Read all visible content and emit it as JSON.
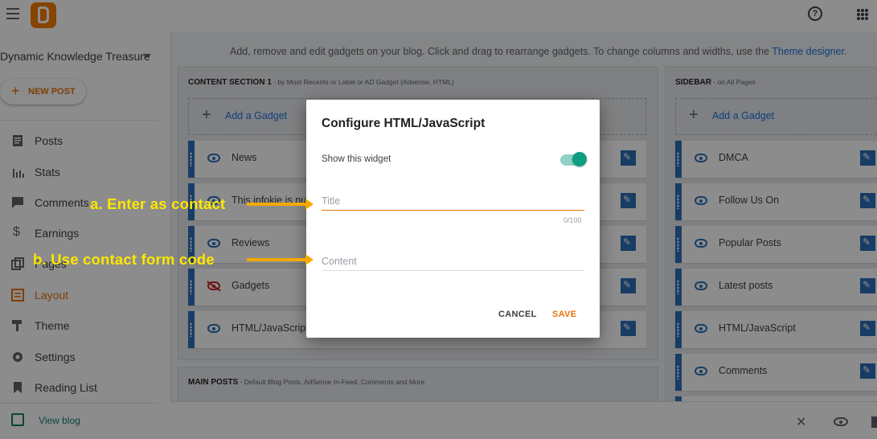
{
  "header": {
    "menu_icon": "hamburger-icon",
    "logo_icon": "blogger-logo-icon",
    "help_icon": "help-icon",
    "apps_icon": "apps-grid-icon"
  },
  "sidebar": {
    "blog_name": "Dynamic Knowledge Treasure",
    "new_post_label": "NEW POST",
    "items": [
      {
        "label": "Posts",
        "icon": "posts-icon"
      },
      {
        "label": "Stats",
        "icon": "stats-icon"
      },
      {
        "label": "Comments",
        "icon": "comments-icon"
      },
      {
        "label": "Earnings",
        "icon": "dollar-icon"
      },
      {
        "label": "Pages",
        "icon": "pages-icon"
      },
      {
        "label": "Layout",
        "icon": "layout-icon",
        "active": true
      },
      {
        "label": "Theme",
        "icon": "paint-roller-icon"
      },
      {
        "label": "Settings",
        "icon": "gear-icon"
      },
      {
        "label": "Reading List",
        "icon": "bookmark-icon"
      }
    ],
    "view_blog_label": "View blog"
  },
  "main": {
    "info_text": "Add, remove and edit gadgets on your blog. Click and drag to rearrange gadgets. To change columns and widths, use the ",
    "info_link": "Theme designer.",
    "content_section": {
      "title": "CONTENT SECTION 1",
      "subtitle": " - by Most Recents or Label or AD Gadget (Adsense, HTML)",
      "add_label": "Add a Gadget",
      "gadgets": [
        {
          "name": "News",
          "visible": true
        },
        {
          "name": "This infokie is nu",
          "visible": true
        },
        {
          "name": "Reviews",
          "visible": true
        },
        {
          "name": "Gadgets",
          "visible": false
        },
        {
          "name": "HTML/JavaScript",
          "visible": true
        }
      ]
    },
    "sidebar_section": {
      "title": "SIDEBAR",
      "subtitle": " - on All Pages",
      "add_label": "Add a Gadget",
      "gadgets": [
        {
          "name": "DMCA",
          "visible": true
        },
        {
          "name": "Follow Us On",
          "visible": true
        },
        {
          "name": "Popular Posts",
          "visible": true
        },
        {
          "name": "Latest posts",
          "visible": true
        },
        {
          "name": "HTML/JavaScript",
          "visible": true
        },
        {
          "name": "Comments",
          "visible": true
        }
      ]
    },
    "main_posts": {
      "title": "MAIN POSTS",
      "subtitle": " - Default Blog Posts, AdSense In-Feed, Comments and More"
    }
  },
  "dialog": {
    "title": "Configure HTML/JavaScript",
    "show_widget_label": "Show this widget",
    "show_widget_on": true,
    "title_placeholder": "Title",
    "title_counter": "0/100",
    "content_placeholder": "Content",
    "cancel_label": "CANCEL",
    "save_label": "SAVE"
  },
  "annotations": {
    "a": "a. Enter as contact",
    "b": "b. Use  contact form code"
  },
  "colors": {
    "accent": "#e8710a",
    "gadget_blue": "#2c6fb7",
    "toggle_green": "#0f9d82",
    "annotation_yellow": "#ffe600"
  }
}
